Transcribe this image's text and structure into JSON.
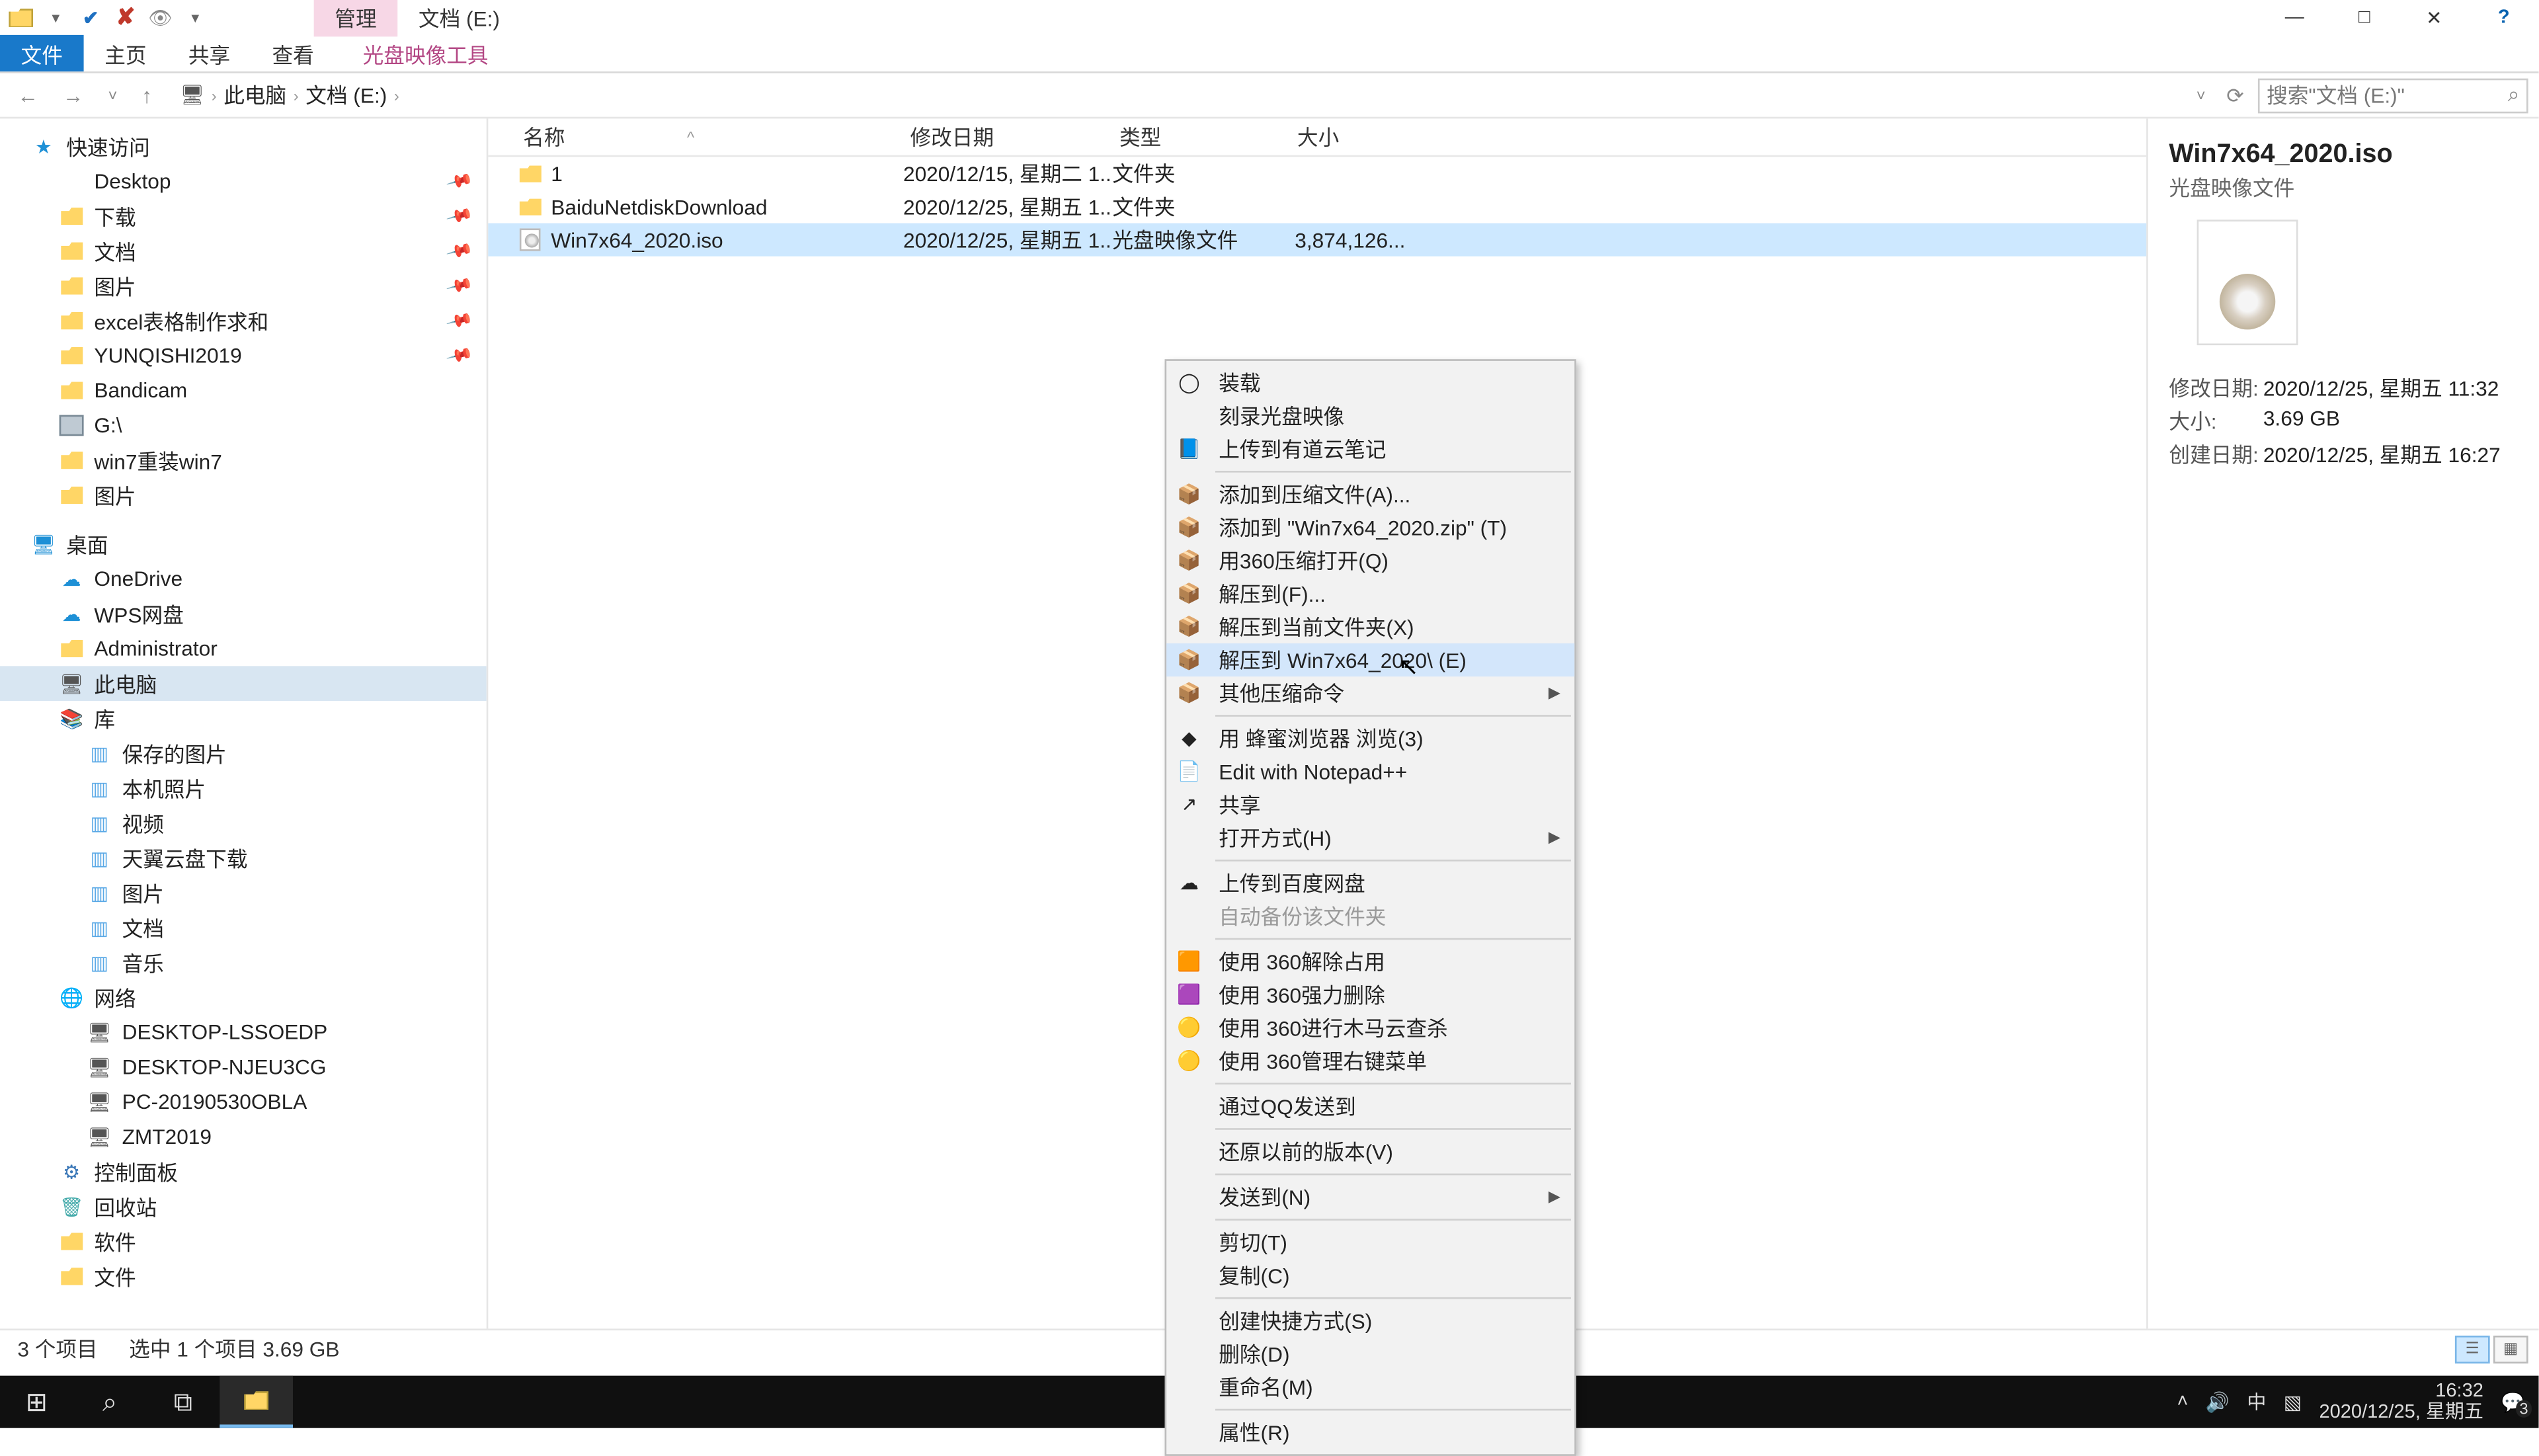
{
  "titlebar": {
    "tab_manage": "管理",
    "tab_loc": "文档 (E:)"
  },
  "window_controls": {
    "min": "—",
    "max": "□",
    "close": "✕",
    "help": "?"
  },
  "ribbon": {
    "file": "文件",
    "home": "主页",
    "share": "共享",
    "view": "查看",
    "tool": "光盘映像工具"
  },
  "nav": {
    "back": "←",
    "fwd": "→",
    "up": "↑",
    "refresh": "⟳",
    "dropdown": "˅"
  },
  "breadcrumb": {
    "root": "此电脑",
    "drive": "文档 (E:)"
  },
  "search": {
    "placeholder": "搜索\"文档 (E:)\"",
    "icon": "⌕"
  },
  "columns": {
    "name": "名称",
    "date": "修改日期",
    "type": "类型",
    "size": "大小"
  },
  "rows": [
    {
      "name": "1",
      "date": "2020/12/15, 星期二 1...",
      "type": "文件夹",
      "size": "",
      "kind": "folder"
    },
    {
      "name": "BaiduNetdiskDownload",
      "date": "2020/12/25, 星期五 1...",
      "type": "文件夹",
      "size": "",
      "kind": "folder"
    },
    {
      "name": "Win7x64_2020.iso",
      "date": "2020/12/25, 星期五 1...",
      "type": "光盘映像文件",
      "size": "3,874,126...",
      "kind": "iso",
      "selected": true
    }
  ],
  "sidebar": {
    "quick": "快速访问",
    "quick_items": [
      {
        "label": "Desktop",
        "pin": true,
        "icon": "desk"
      },
      {
        "label": "下载",
        "pin": true,
        "icon": "fold"
      },
      {
        "label": "文档",
        "pin": true,
        "icon": "fold"
      },
      {
        "label": "图片",
        "pin": true,
        "icon": "fold"
      },
      {
        "label": "excel表格制作求和",
        "pin": true,
        "icon": "fold"
      },
      {
        "label": "YUNQISHI2019",
        "pin": true,
        "icon": "fold"
      },
      {
        "label": "Bandicam",
        "pin": false,
        "icon": "fold"
      },
      {
        "label": "G:\\",
        "pin": false,
        "icon": "disk"
      },
      {
        "label": "win7重装win7",
        "pin": false,
        "icon": "fold"
      },
      {
        "label": "图片",
        "pin": false,
        "icon": "fold"
      }
    ],
    "desktop": "桌面",
    "desktop_items": [
      {
        "label": "OneDrive",
        "icon": "cloud"
      },
      {
        "label": "WPS网盘",
        "icon": "cloud"
      },
      {
        "label": "Administrator",
        "icon": "fold"
      },
      {
        "label": "此电脑",
        "icon": "pc",
        "selected": true
      },
      {
        "label": "库",
        "icon": "lib"
      }
    ],
    "lib_items": [
      {
        "label": "保存的图片"
      },
      {
        "label": "本机照片"
      },
      {
        "label": "视频"
      },
      {
        "label": "天翼云盘下载"
      },
      {
        "label": "图片"
      },
      {
        "label": "文档"
      },
      {
        "label": "音乐"
      }
    ],
    "network": "网络",
    "net_items": [
      {
        "label": "DESKTOP-LSSOEDP"
      },
      {
        "label": "DESKTOP-NJEU3CG"
      },
      {
        "label": "PC-20190530OBLA"
      },
      {
        "label": "ZMT2019"
      }
    ],
    "tail_items": [
      {
        "label": "控制面板",
        "icon": "ctl"
      },
      {
        "label": "回收站",
        "icon": "recy"
      },
      {
        "label": "软件",
        "icon": "fold"
      },
      {
        "label": "文件",
        "icon": "fold"
      }
    ]
  },
  "context_menu": {
    "groups": [
      [
        {
          "label": "装载",
          "icon": "◯"
        },
        {
          "label": "刻录光盘映像",
          "icon": ""
        },
        {
          "label": "上传到有道云笔记",
          "icon": "📘"
        }
      ],
      [
        {
          "label": "添加到压缩文件(A)...",
          "icon": "📦"
        },
        {
          "label": "添加到 \"Win7x64_2020.zip\" (T)",
          "icon": "📦"
        },
        {
          "label": "用360压缩打开(Q)",
          "icon": "📦"
        },
        {
          "label": "解压到(F)...",
          "icon": "📦"
        },
        {
          "label": "解压到当前文件夹(X)",
          "icon": "📦"
        },
        {
          "label": "解压到 Win7x64_2020\\ (E)",
          "icon": "📦",
          "hl": true
        },
        {
          "label": "其他压缩命令",
          "icon": "📦",
          "sub": true
        }
      ],
      [
        {
          "label": "用 蜂蜜浏览器 浏览(3)",
          "icon": "◆"
        },
        {
          "label": "Edit with Notepad++",
          "icon": "📄"
        },
        {
          "label": "共享",
          "icon": "↗"
        },
        {
          "label": "打开方式(H)",
          "icon": "",
          "sub": true
        }
      ],
      [
        {
          "label": "上传到百度网盘",
          "icon": "☁"
        },
        {
          "label": "自动备份该文件夹",
          "icon": "",
          "disabled": true
        }
      ],
      [
        {
          "label": "使用 360解除占用",
          "icon": "🟧"
        },
        {
          "label": "使用 360强力删除",
          "icon": "🟪"
        },
        {
          "label": "使用 360进行木马云查杀",
          "icon": "🟡"
        },
        {
          "label": "使用 360管理右键菜单",
          "icon": "🟡"
        }
      ],
      [
        {
          "label": "通过QQ发送到",
          "icon": ""
        }
      ],
      [
        {
          "label": "还原以前的版本(V)",
          "icon": ""
        }
      ],
      [
        {
          "label": "发送到(N)",
          "icon": "",
          "sub": true
        }
      ],
      [
        {
          "label": "剪切(T)",
          "icon": ""
        },
        {
          "label": "复制(C)",
          "icon": ""
        }
      ],
      [
        {
          "label": "创建快捷方式(S)",
          "icon": ""
        },
        {
          "label": "删除(D)",
          "icon": ""
        },
        {
          "label": "重命名(M)",
          "icon": ""
        }
      ],
      [
        {
          "label": "属性(R)",
          "icon": ""
        }
      ]
    ]
  },
  "details": {
    "title": "Win7x64_2020.iso",
    "subtitle": "光盘映像文件",
    "meta": [
      {
        "k": "修改日期:",
        "v": "2020/12/25, 星期五 11:32"
      },
      {
        "k": "大小:",
        "v": "3.69 GB"
      },
      {
        "k": "创建日期:",
        "v": "2020/12/25, 星期五 16:27"
      }
    ]
  },
  "status": {
    "count": "3 个项目",
    "selection": "选中 1 个项目  3.69 GB"
  },
  "taskbar": {
    "time": "16:32",
    "date": "2020/12/25, 星期五",
    "ime": "中",
    "notif_count": "3"
  }
}
